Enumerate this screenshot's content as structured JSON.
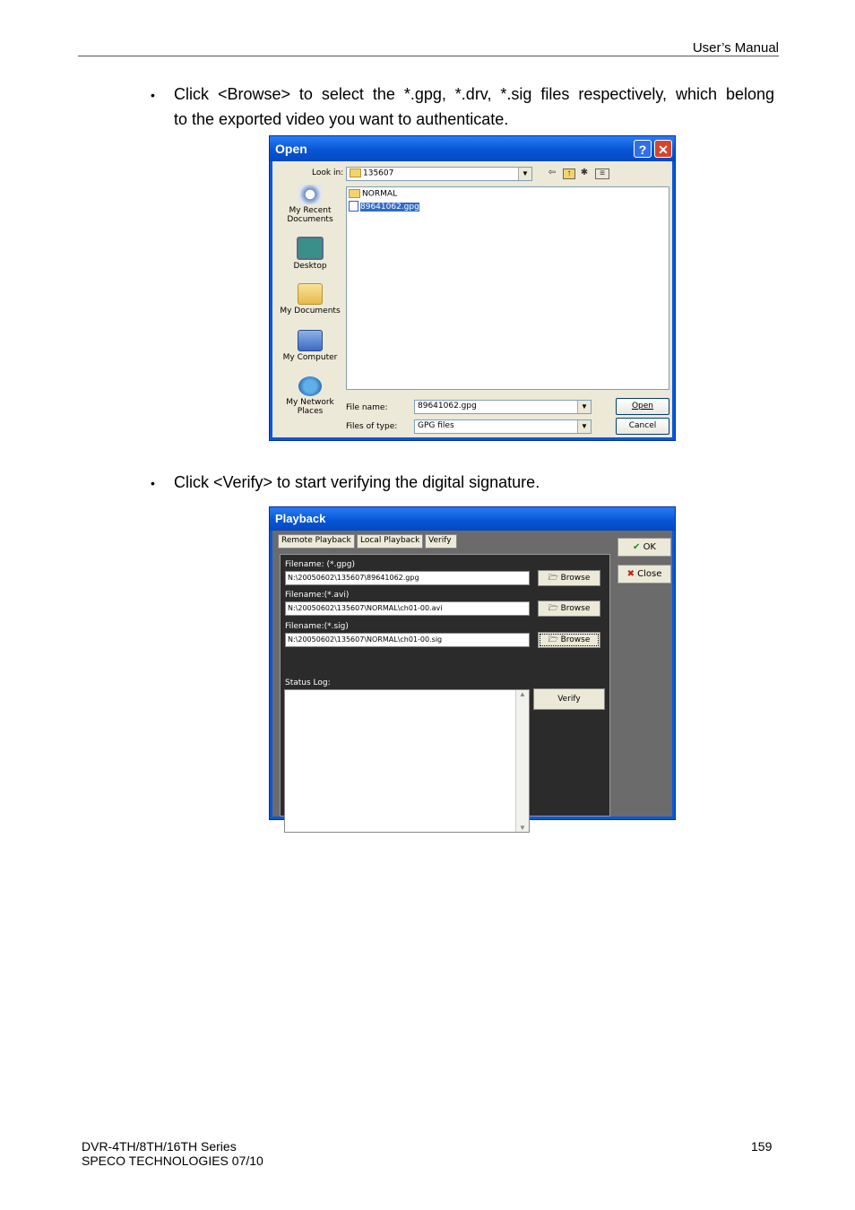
{
  "header": {
    "title": "User’s Manual"
  },
  "bullets": [
    {
      "line1": "Click <Browse> to select the *.gpg, *.drv, *.sig files respectively, which belong",
      "line2": "to the exported video you want to authenticate."
    },
    {
      "line1": "Click <Verify> to start verifying the digital signature."
    }
  ],
  "open_dialog": {
    "title": "Open",
    "help_label": "?",
    "close_label": "✕",
    "look_in_label": "Look in:",
    "look_in_value": "135607",
    "places": [
      {
        "label": "My Recent Documents",
        "icon": "recent-documents-icon"
      },
      {
        "label": "Desktop",
        "icon": "desktop-icon"
      },
      {
        "label": "My Documents",
        "icon": "my-documents-icon"
      },
      {
        "label": "My Computer",
        "icon": "my-computer-icon"
      },
      {
        "label": "My Network Places",
        "icon": "network-places-icon"
      }
    ],
    "files": [
      {
        "name": "NORMAL",
        "type": "folder"
      },
      {
        "name": "89641062.gpg",
        "type": "file",
        "selected": true
      }
    ],
    "file_name_label": "File name:",
    "file_name_value": "89641062.gpg",
    "file_type_label": "Files of type:",
    "file_type_value": "GPG files",
    "open_button": "Open",
    "cancel_button": "Cancel"
  },
  "playback_dialog": {
    "title": "Playback",
    "tabs": [
      "Remote Playback",
      "Local Playback",
      "Verify"
    ],
    "fields": [
      {
        "label": "Filename: (*.gpg)",
        "value": "N:\\20050602\\135607\\89641062.gpg",
        "button": "Browse"
      },
      {
        "label": "Filename:(*.avi)",
        "value": "N:\\20050602\\135607\\NORMAL\\ch01-00.avi",
        "button": "Browse"
      },
      {
        "label": "Filename:(*.sig)",
        "value": "N:\\20050602\\135607\\NORMAL\\ch01-00.sig",
        "button": "Browse"
      }
    ],
    "status_log_label": "Status Log:",
    "verify_button": "Verify",
    "ok_button": "OK",
    "close_button": "Close"
  },
  "footer": {
    "line1": "DVR-4TH/8TH/16TH Series",
    "line2": "SPECO TECHNOLOGIES 07/10",
    "page_number": "159"
  },
  "colors": {
    "title_bar": "#0856d6",
    "selection": "#316ac5",
    "dialog_bg": "#ece9d8",
    "panel_dark": "#2b2b2b"
  }
}
